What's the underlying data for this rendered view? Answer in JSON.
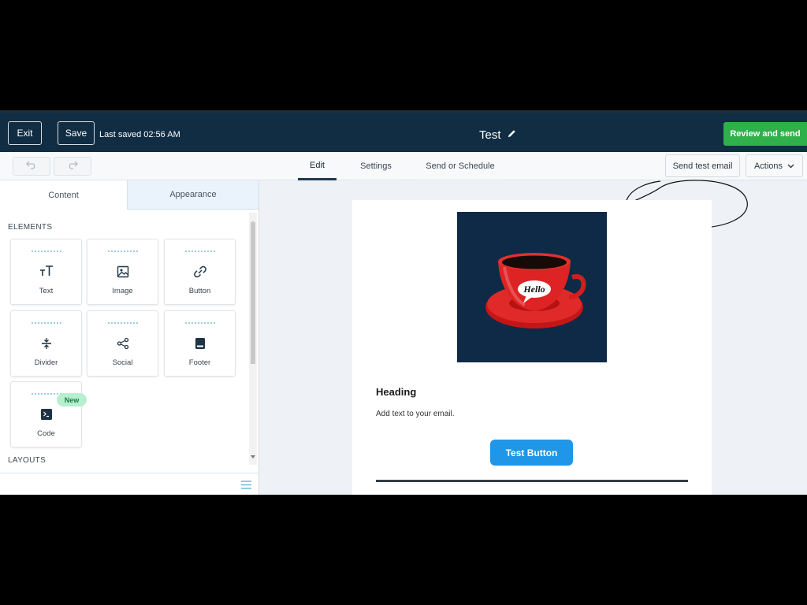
{
  "header": {
    "exit_label": "Exit",
    "save_label": "Save",
    "last_saved": "Last saved 02:56 AM",
    "title": "Test",
    "review_label": "Review and send"
  },
  "toolbar": {
    "tabs": [
      {
        "label": "Edit",
        "active": true
      },
      {
        "label": "Settings",
        "active": false
      },
      {
        "label": "Send or Schedule",
        "active": false
      }
    ],
    "send_test_label": "Send test email",
    "actions_label": "Actions"
  },
  "sidebar": {
    "tabs": [
      {
        "label": "Content",
        "active": true
      },
      {
        "label": "Appearance",
        "active": false
      }
    ],
    "elements_label": "ELEMENTS",
    "layouts_label": "LAYOUTS",
    "elements": [
      {
        "label": "Text",
        "icon": "text-icon"
      },
      {
        "label": "Image",
        "icon": "image-icon"
      },
      {
        "label": "Button",
        "icon": "link-icon"
      },
      {
        "label": "Divider",
        "icon": "divider-icon"
      },
      {
        "label": "Social",
        "icon": "share-icon"
      },
      {
        "label": "Footer",
        "icon": "footer-icon"
      },
      {
        "label": "Code",
        "icon": "terminal-icon",
        "badge": "New"
      }
    ]
  },
  "email": {
    "image_caption": "Hello",
    "heading": "Heading",
    "body": "Add text to your email.",
    "button_label": "Test Button"
  },
  "colors": {
    "header_bg": "#112d43",
    "review_green": "#2fb04a",
    "button_blue": "#1f96e8",
    "badge_green": "#b6f0cf"
  }
}
